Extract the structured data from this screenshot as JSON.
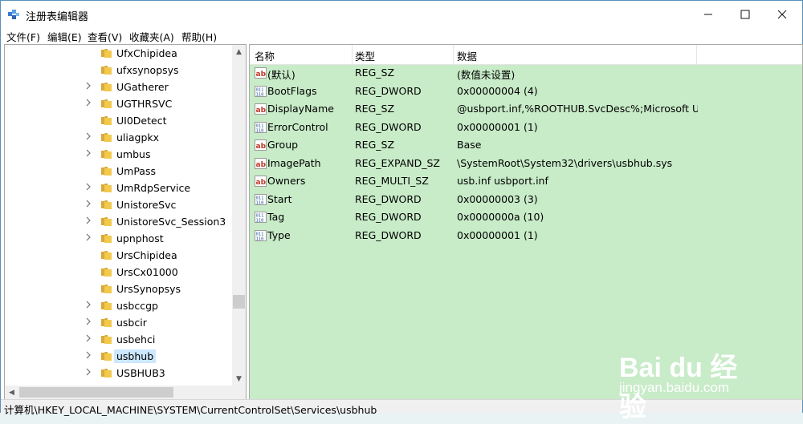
{
  "window": {
    "title": "注册表编辑器"
  },
  "menu": [
    "文件(F)",
    "编辑(E)",
    "查看(V)",
    "收藏夹(A)",
    "帮助(H)"
  ],
  "tree": {
    "items": [
      {
        "label": "UfxChipidea",
        "expandable": false,
        "selected": false
      },
      {
        "label": "ufxsynopsys",
        "expandable": false,
        "selected": false
      },
      {
        "label": "UGatherer",
        "expandable": true,
        "selected": false
      },
      {
        "label": "UGTHRSVC",
        "expandable": true,
        "selected": false
      },
      {
        "label": "UI0Detect",
        "expandable": false,
        "selected": false
      },
      {
        "label": "uliagpkx",
        "expandable": true,
        "selected": false
      },
      {
        "label": "umbus",
        "expandable": true,
        "selected": false
      },
      {
        "label": "UmPass",
        "expandable": false,
        "selected": false
      },
      {
        "label": "UmRdpService",
        "expandable": true,
        "selected": false
      },
      {
        "label": "UnistoreSvc",
        "expandable": true,
        "selected": false
      },
      {
        "label": "UnistoreSvc_Session3",
        "expandable": true,
        "selected": false
      },
      {
        "label": "upnphost",
        "expandable": true,
        "selected": false
      },
      {
        "label": "UrsChipidea",
        "expandable": false,
        "selected": false
      },
      {
        "label": "UrsCx01000",
        "expandable": false,
        "selected": false
      },
      {
        "label": "UrsSynopsys",
        "expandable": false,
        "selected": false
      },
      {
        "label": "usbccgp",
        "expandable": true,
        "selected": false
      },
      {
        "label": "usbcir",
        "expandable": true,
        "selected": false
      },
      {
        "label": "usbehci",
        "expandable": true,
        "selected": false
      },
      {
        "label": "usbhub",
        "expandable": true,
        "selected": true
      },
      {
        "label": "USBHUB3",
        "expandable": true,
        "selected": false
      }
    ]
  },
  "list": {
    "columns": {
      "name": "名称",
      "type": "类型",
      "data": "数据"
    },
    "rows": [
      {
        "icon": "string",
        "name": "(默认)",
        "type": "REG_SZ",
        "data": "(数值未设置)"
      },
      {
        "icon": "binary",
        "name": "BootFlags",
        "type": "REG_DWORD",
        "data": "0x00000004 (4)"
      },
      {
        "icon": "string",
        "name": "DisplayName",
        "type": "REG_SZ",
        "data": "@usbport.inf,%ROOTHUB.SvcDesc%;Microsoft US..."
      },
      {
        "icon": "binary",
        "name": "ErrorControl",
        "type": "REG_DWORD",
        "data": "0x00000001 (1)"
      },
      {
        "icon": "string",
        "name": "Group",
        "type": "REG_SZ",
        "data": "Base"
      },
      {
        "icon": "string",
        "name": "ImagePath",
        "type": "REG_EXPAND_SZ",
        "data": "\\SystemRoot\\System32\\drivers\\usbhub.sys"
      },
      {
        "icon": "string",
        "name": "Owners",
        "type": "REG_MULTI_SZ",
        "data": "usb.inf usbport.inf"
      },
      {
        "icon": "binary",
        "name": "Start",
        "type": "REG_DWORD",
        "data": "0x00000003 (3)"
      },
      {
        "icon": "binary",
        "name": "Tag",
        "type": "REG_DWORD",
        "data": "0x0000000a (10)"
      },
      {
        "icon": "binary",
        "name": "Type",
        "type": "REG_DWORD",
        "data": "0x00000001 (1)"
      }
    ]
  },
  "status": {
    "path": "计算机\\HKEY_LOCAL_MACHINE\\SYSTEM\\CurrentControlSet\\Services\\usbhub"
  },
  "watermark": {
    "brand": "Bai du 经验",
    "url": "jingyan.baidu.com"
  },
  "colors": {
    "list_background": "#c8ebc8",
    "folder": "#f2c94c",
    "selection": "#cce8ff"
  }
}
